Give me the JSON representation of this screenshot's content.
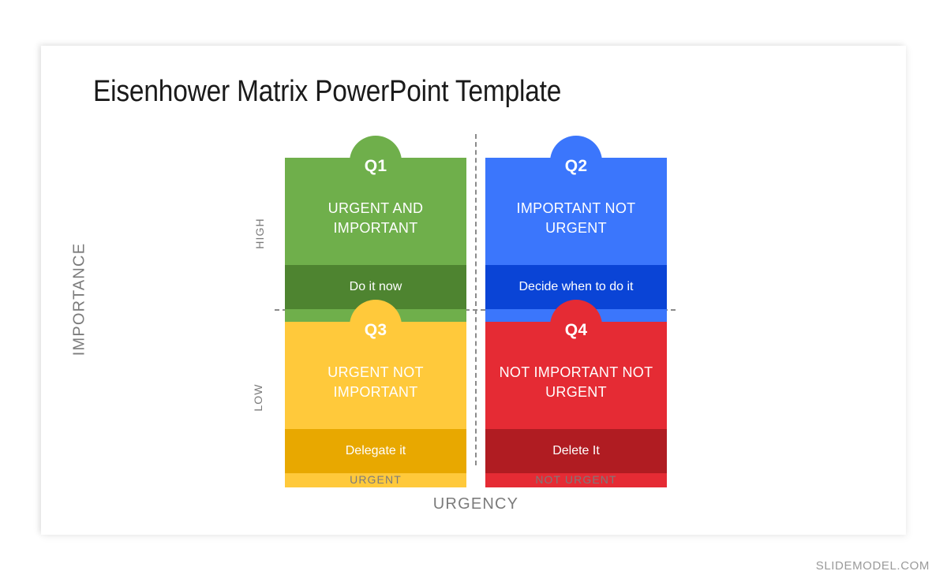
{
  "slide": {
    "title": "Eisenhower Matrix PowerPoint Template"
  },
  "matrix": {
    "quadrants": [
      {
        "id": "q1",
        "tab": "Q1",
        "heading": "URGENT AND IMPORTANT",
        "action": "Do it now",
        "color": "#6FAF4B",
        "color_dark": "#4E8430"
      },
      {
        "id": "q2",
        "tab": "Q2",
        "heading": "IMPORTANT NOT URGENT",
        "action": "Decide when to do it",
        "color": "#3B76FC",
        "color_dark": "#0A44D6"
      },
      {
        "id": "q3",
        "tab": "Q3",
        "heading": "URGENT NOT IMPORTANT",
        "action": "Delegate it",
        "color": "#FFC93B",
        "color_dark": "#E8A800"
      },
      {
        "id": "q4",
        "tab": "Q4",
        "heading": "NOT IMPORTANT NOT URGENT",
        "action": "Delete It",
        "color": "#E52B34",
        "color_dark": "#B01C22"
      }
    ],
    "axes": {
      "y_title": "IMPORTANCE",
      "y_high": "HIGH",
      "y_low": "LOW",
      "x_title": "URGENCY",
      "x_left": "URGENT",
      "x_right": "NOT URGENT"
    }
  },
  "watermark": "SLIDEMODEL.COM"
}
